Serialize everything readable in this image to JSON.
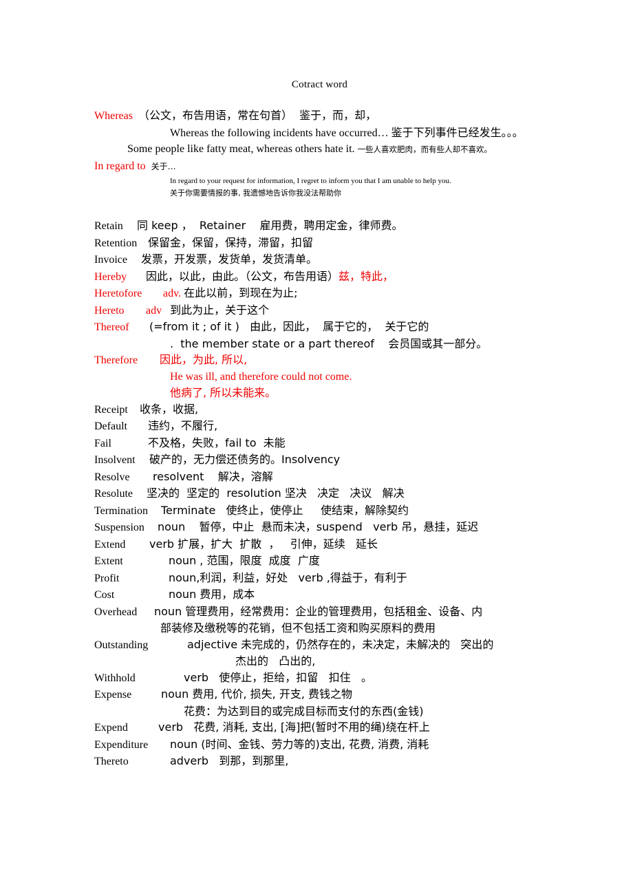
{
  "document": {
    "title": "Cotract word",
    "colors": {
      "accent_red": "#ee0000",
      "text_black": "#000000",
      "page_background": "#ffffff"
    }
  },
  "entries": {
    "whereas": {
      "headword": "Whereas",
      "gloss": "（公文，布告用语，常在句首）  鉴于，而，却，",
      "example_en": "Whereas the following incidents have occurred…",
      "example_cn": "鉴于下列事件已经发生。。。",
      "example2_en": "Some people like fatty meat, whereas others hate it.",
      "example2_cn": "一些人喜欢肥肉，而有些人却不喜欢。"
    },
    "in_regard_to": {
      "headword": "In regard to",
      "gloss": "关于…",
      "example_en": "In regard to your request for information, I regret to inform you that I am unable to help you.",
      "example_cn": "关于你需要情报的事, 我遗憾地告诉你我没法帮助你"
    },
    "retain": {
      "headword": "Retain",
      "body": "同 keep ，  Retainer    雇用费，聘用定金，律师费。"
    },
    "retention": {
      "headword": "Retention",
      "body": "保留金，保留，保持，滞留，扣留"
    },
    "invoice": {
      "headword": "Invoice",
      "body": "发票，开发票，发货单，发货清单。"
    },
    "hereby": {
      "headword": "Hereby",
      "body_black": "因此，以此，由此。（公文，布告用语）",
      "body_red": "兹，特此，"
    },
    "heretofore": {
      "headword": "Heretofore",
      "pos": "adv.",
      "body": "在此以前，到现在为止;"
    },
    "hereto": {
      "headword": "Hereto",
      "pos": "adv",
      "body": "到此为止，关于这个"
    },
    "thereof": {
      "headword": "Thereof",
      "body": "(=from it ; of it )   由此，因此，  属于它的，  关于它的",
      "example": ".  the member state or a part thereof    会员国或其一部分。"
    },
    "therefore": {
      "headword": "Therefore",
      "body": "因此，为此, 所以,",
      "example_en": "He was ill, and therefore could not come.",
      "example_cn": "他病了, 所以未能来。"
    },
    "receipt": {
      "headword": "Receipt",
      "body": "收条，收据,"
    },
    "default": {
      "headword": "Default",
      "body": "违约，不履行,"
    },
    "fail": {
      "headword": "Fail",
      "body": "不及格，失败，fail to  未能"
    },
    "insolvent": {
      "headword": "Insolvent",
      "body": "破产的，无力偿还债务的。Insolvency"
    },
    "resolve": {
      "headword": "Resolve",
      "body": "resolvent    解决，溶解"
    },
    "resolute": {
      "headword": "Resolute",
      "body": "坚决的  坚定的  resolution 坚决   决定   决议   解决"
    },
    "termination": {
      "headword": "Termination",
      "body": "Terminate   使终止，使停止     使结束，解除契约"
    },
    "suspension": {
      "headword": "Suspension",
      "body": "noun    暂停，中止  悬而未决，suspend   verb 吊，悬挂，延迟"
    },
    "extend": {
      "headword": "Extend",
      "body": "verb 扩展，扩大  扩散  ，   引伸，延续   延长"
    },
    "extent": {
      "headword": "Extent",
      "body": "noun , 范围，限度  成度  广度"
    },
    "profit": {
      "headword": "Profit",
      "body": "noun,利润，利益，好处   verb ,得益于，有利于"
    },
    "cost": {
      "headword": "Cost",
      "body": "noun 费用，成本"
    },
    "overhead": {
      "headword": "Overhead",
      "body": "noun 管理费用，经常费用：企业的管理费用，包括租金、设备、内",
      "body_cont": "部装修及缴税等的花销，但不包括工资和购买原料的费用"
    },
    "outstanding": {
      "headword": "Outstanding",
      "body": "adjective 未完成的，仍然存在的，未决定，未解决的   突出的",
      "body_cont": "杰出的   凸出的,"
    },
    "withhold": {
      "headword": "Withhold",
      "body": "verb   使停止，拒给，扣留   扣住   。"
    },
    "expense": {
      "headword": "Expense",
      "body": "noun 费用, 代价, 损失, 开支, 费钱之物",
      "body_cont": "花费：为达到目的或完成目标而支付的东西(金钱)"
    },
    "expend": {
      "headword": "Expend",
      "body": "verb   花费, 消耗, 支出, [海]把(暂时不用的绳)绕在杆上"
    },
    "expenditure": {
      "headword": "Expenditure",
      "body": "noun (时间、金钱、劳力等的)支出, 花费, 消费, 消耗"
    },
    "thereto": {
      "headword": "Thereto",
      "body": "adverb   到那，到那里,"
    }
  }
}
